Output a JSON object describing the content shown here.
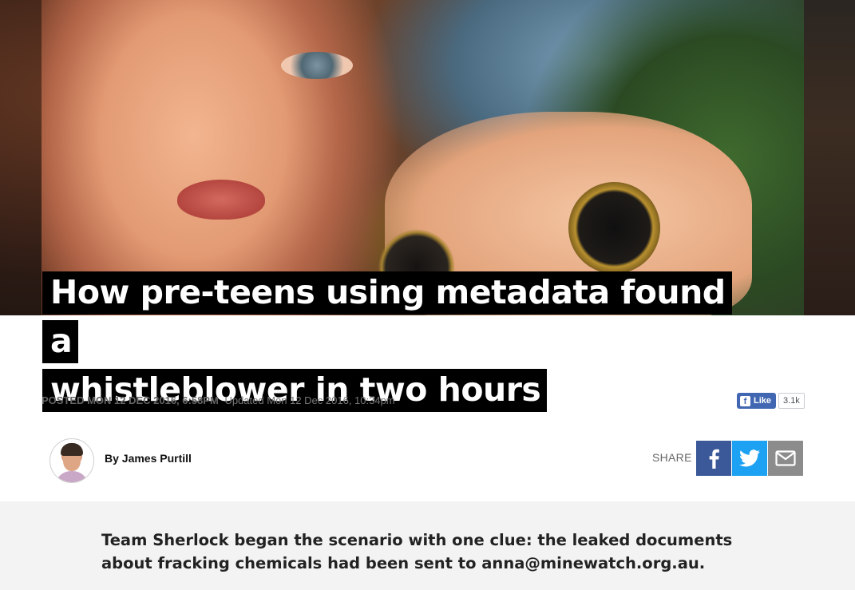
{
  "article": {
    "headline_line1": "How pre-teens using metadata found a",
    "headline_line2": "whistleblower in two hours",
    "posted": "POSTED MON 12 DEC 2016, 6:58PM",
    "updated": "Updated Mon 12 Dec 2016, 10:34pm",
    "byline": "By James Purtill",
    "lead": "Team Sherlock began the scenario with one clue: the leaked documents about fracking chemicals had been sent to anna@minewatch.org.au."
  },
  "facebook_like": {
    "label": "Like",
    "count": "3.1k",
    "color": "#4267b2"
  },
  "share": {
    "label": "SHARE",
    "buttons": [
      {
        "name": "facebook",
        "icon": "facebook-icon",
        "color": "#3b5998"
      },
      {
        "name": "twitter",
        "icon": "twitter-icon",
        "color": "#1da1f2"
      },
      {
        "name": "email",
        "icon": "email-icon",
        "color": "#8c8c8c"
      }
    ]
  },
  "hero_image": {
    "subject": "girl-with-binoculars-photo"
  }
}
